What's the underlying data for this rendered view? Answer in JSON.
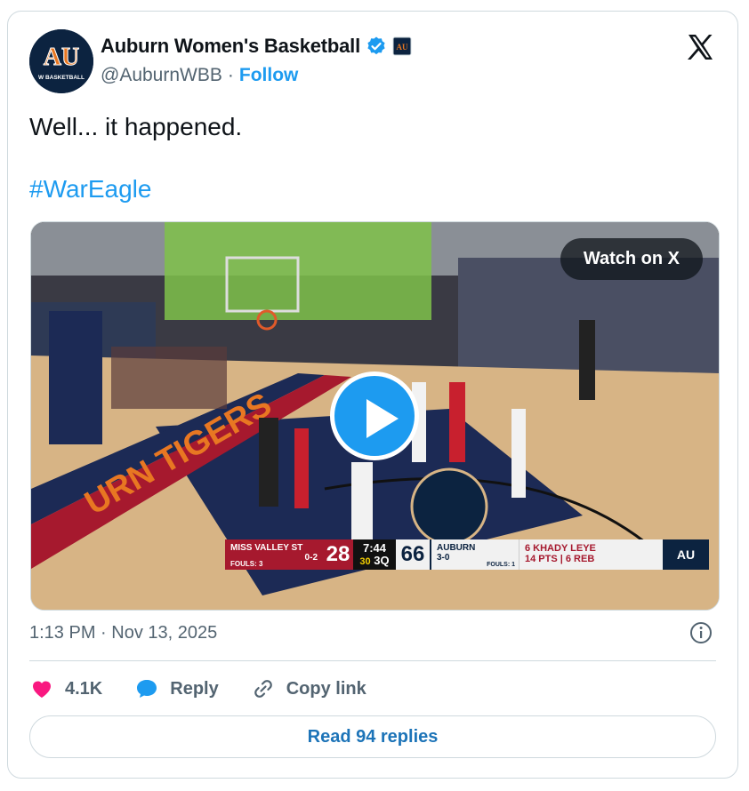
{
  "author": {
    "name": "Auburn Women's Basketball",
    "handle": "@AuburnWBB",
    "separator": "·",
    "follow_label": "Follow",
    "avatar_text": "W BASKETBALL",
    "avatar_monogram": "AU"
  },
  "tweet": {
    "text": "Well... it happened.",
    "hashtag": "#WarEagle"
  },
  "media": {
    "watch_label": "Watch on X",
    "court_text": "URN TIGERS",
    "scoreboard": {
      "away_name": "MISS VALLEY ST",
      "away_record": "0-2",
      "away_fouls": "FOULS: 3",
      "away_score": "28",
      "clock": "7:44",
      "shot_clock": "30",
      "quarter": "3Q",
      "home_score": "66",
      "home_name": "AUBURN",
      "home_record": "3-0",
      "home_fouls": "FOULS: 1",
      "player_line": "6 KHADY LEYE",
      "player_stats": "14 PTS | 6 REB",
      "logo_text": "AU"
    }
  },
  "meta": {
    "timestamp": "1:13 PM · Nov 13, 2025"
  },
  "actions": {
    "likes": "4.1K",
    "reply_label": "Reply",
    "copy_label": "Copy link"
  },
  "replies_button": "Read 94 replies",
  "colors": {
    "accent": "#1d9bf0",
    "like": "#f91880",
    "auburn_navy": "#0c2340",
    "auburn_orange": "#e87722"
  }
}
